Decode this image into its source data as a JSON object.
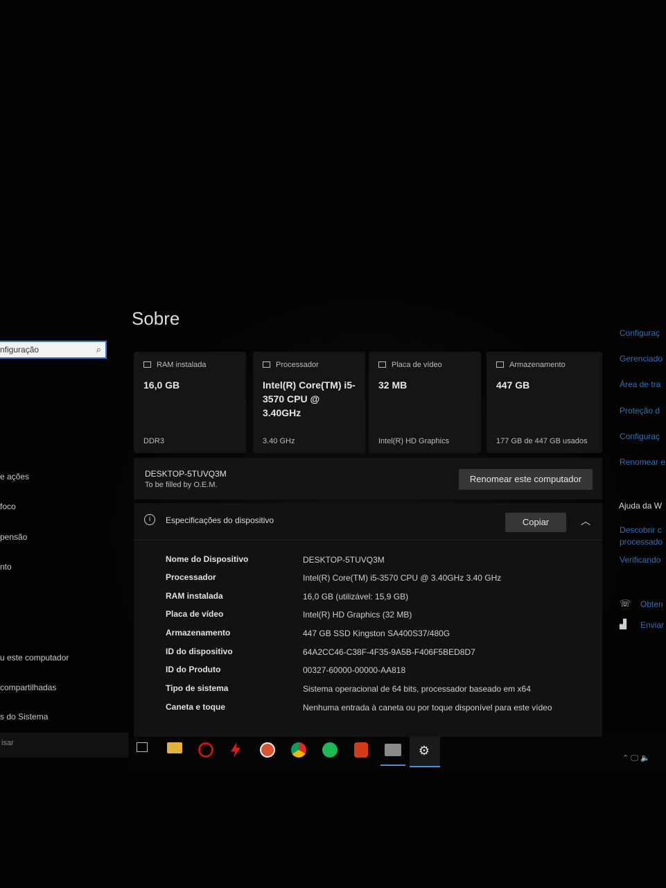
{
  "nav": {
    "search_value": "nfiguração",
    "items": [
      "e ações",
      "foco",
      "pensão",
      "nto",
      "u este computador",
      "compartilhadas",
      "s do Sistema"
    ],
    "bottom_search": "isar"
  },
  "page_title": "Sobre",
  "cards": [
    {
      "label": "RAM instalada",
      "value": "16,0 GB",
      "foot": "DDR3"
    },
    {
      "label": "Processador",
      "value": "Intel(R) Core(TM) i5-3570 CPU @ 3.40GHz",
      "foot": "3.40 GHz"
    },
    {
      "label": "Placa de vídeo",
      "value": "32 MB",
      "foot": "Intel(R) HD Graphics"
    },
    {
      "label": "Armazenamento",
      "value": "447 GB",
      "foot": "177 GB de 447 GB usados"
    }
  ],
  "device": {
    "name": "DESKTOP-5TUVQ3M",
    "subtitle": "To be filled by O.E.M.",
    "rename_label": "Renomear este computador"
  },
  "specs": {
    "title": "Especificações do dispositivo",
    "copy_label": "Copiar",
    "rows": [
      {
        "key": "Nome do Dispositivo",
        "value": "DESKTOP-5TUVQ3M"
      },
      {
        "key": "Processador",
        "value": "Intel(R) Core(TM) i5-3570 CPU @ 3.40GHz   3.40 GHz"
      },
      {
        "key": "RAM instalada",
        "value": "16,0 GB (utilizável: 15,9 GB)"
      },
      {
        "key": "Placa de vídeo",
        "value": "Intel(R) HD Graphics (32 MB)"
      },
      {
        "key": "Armazenamento",
        "value": "447 GB SSD Kingston SA400S37/480G"
      },
      {
        "key": "ID do dispositivo",
        "value": "64A2CC46-C38F-4F35-9A5B-F406F5BED8D7"
      },
      {
        "key": "ID do Produto",
        "value": "00327-60000-00000-AA818"
      },
      {
        "key": "Tipo de sistema",
        "value": "Sistema operacional de 64 bits, processador baseado em x64"
      },
      {
        "key": "Caneta e toque",
        "value": "Nenhuma entrada à caneta ou por toque disponível para este vídeo"
      }
    ]
  },
  "right": {
    "links": [
      "Configuraç",
      "Gerenciado",
      "Área de tra",
      "Proteção d",
      "Configuraç",
      "Renomear e"
    ],
    "help_title": "Ajuda da W",
    "help_links": [
      "Descobrir c",
      "processado",
      "Verificando"
    ],
    "actions": [
      "Obten",
      "Enviar"
    ]
  },
  "taskbar": {
    "apps": [
      "task-view",
      "file-explorer",
      "opera",
      "red-bolt-app",
      "duckduckgo",
      "chrome",
      "spotify",
      "brave",
      "photos",
      "settings"
    ],
    "colors": {
      "opera": "#c0161b",
      "chrome": "#2c8f3b",
      "spotify": "#1db954",
      "brave": "#d63a1c",
      "settings_active": "#4a90d9"
    }
  }
}
